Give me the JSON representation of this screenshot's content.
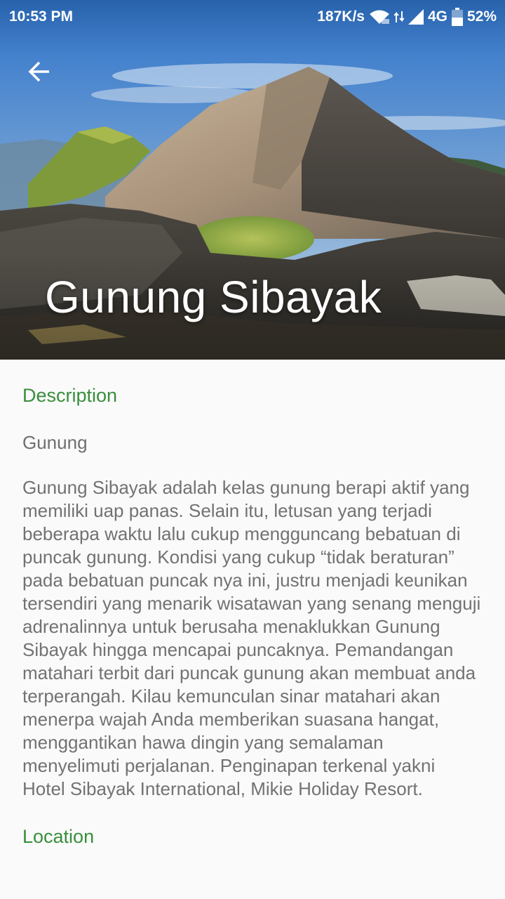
{
  "status_bar": {
    "time": "10:53 PM",
    "network_speed": "187K/s",
    "network_type": "4G",
    "battery": "52%",
    "icons": [
      "wifi-icon",
      "data-arrows-icon",
      "signal-icon",
      "battery-icon"
    ]
  },
  "header": {
    "back_icon": "arrow-left-icon",
    "title": "Gunung Sibayak",
    "image": "mountain-crater-photo"
  },
  "sections": {
    "description_heading": "Description",
    "category": "Gunung",
    "description": "Gunung Sibayak adalah kelas gunung berapi aktif yang memiliki uap panas. Selain itu, letusan yang terjadi beberapa waktu lalu cukup mengguncang bebatuan di puncak gunung. Kondisi yang cukup “tidak beraturan” pada bebatuan puncak nya ini, justru menjadi keunikan tersendiri yang menarik wisatawan yang senang menguji adrenalinnya untuk berusaha menaklukkan Gunung Sibayak hingga mencapai puncaknya. Pemandangan matahari terbit dari puncak gunung akan membuat anda terperangah. Kilau kemunculan sinar matahari akan menerpa wajah Anda memberikan suasana hangat, menggantikan hawa dingin yang semalaman menyelimuti perjalanan. Penginapan terkenal yakni Hotel Sibayak International, Mikie Holiday Resort.",
    "location_heading": "Location"
  },
  "colors": {
    "accent": "#388e3c",
    "body_text": "#727272",
    "background": "#fafafa"
  }
}
